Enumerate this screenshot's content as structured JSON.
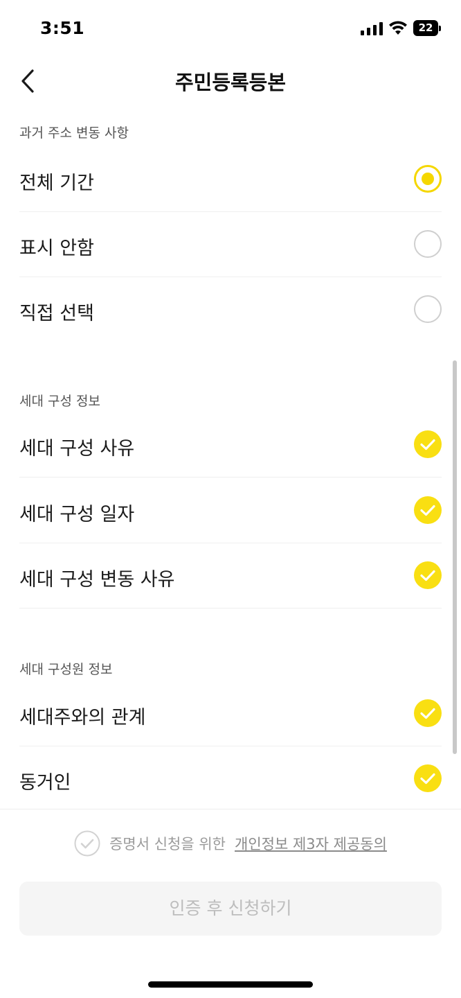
{
  "status_bar": {
    "time": "3:51",
    "battery": "22",
    "icons": [
      "signal-icon",
      "wifi-icon",
      "battery-icon"
    ]
  },
  "header": {
    "title": "주민등록등본",
    "back_icon": "chevron-left-icon"
  },
  "past_address": {
    "label": "과거 주소 변동 사항",
    "options": [
      {
        "label": "전체 기간",
        "selected": true
      },
      {
        "label": "표시 안함",
        "selected": false
      },
      {
        "label": "직접 선택",
        "selected": false
      }
    ]
  },
  "household_info": {
    "label": "세대 구성 정보",
    "items": [
      {
        "label": "세대 구성 사유",
        "checked": true
      },
      {
        "label": "세대 구성 일자",
        "checked": true
      },
      {
        "label": "세대 구성 변동 사유",
        "checked": true
      }
    ]
  },
  "member_info": {
    "label": "세대 구성원 정보",
    "items": [
      {
        "label": "세대주와의 관계",
        "checked": true
      },
      {
        "label": "동거인",
        "checked": true
      }
    ]
  },
  "consent": {
    "text": "증명서 신청을 위한",
    "link": "개인정보 제3자 제공동의",
    "checked": false
  },
  "submit": {
    "label": "인증 후 신청하기",
    "enabled": false
  },
  "colors": {
    "accent": "#f9df12",
    "radio_border": "#cfcfcf",
    "disabled_bg": "#f5f5f5",
    "disabled_text": "#bdbdbd"
  }
}
